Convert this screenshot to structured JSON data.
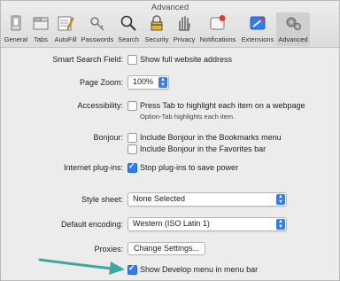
{
  "window": {
    "title": "Advanced"
  },
  "toolbar": {
    "items": [
      {
        "label": "General",
        "icon": "general-icon"
      },
      {
        "label": "Tabs",
        "icon": "tabs-icon"
      },
      {
        "label": "AutoFill",
        "icon": "autofill-icon"
      },
      {
        "label": "Passwords",
        "icon": "key-icon"
      },
      {
        "label": "Search",
        "icon": "magnifier-icon"
      },
      {
        "label": "Security",
        "icon": "lock-icon"
      },
      {
        "label": "Privacy",
        "icon": "hand-icon"
      },
      {
        "label": "Notifications",
        "icon": "notifications-icon"
      },
      {
        "label": "Extensions",
        "icon": "puzzle-icon"
      },
      {
        "label": "Advanced",
        "icon": "gears-icon",
        "active": true
      }
    ]
  },
  "settings": {
    "smart_search_label": "Smart Search Field:",
    "smart_search_option": "Show full website address",
    "page_zoom_label": "Page Zoom:",
    "page_zoom_value": "100%",
    "accessibility_label": "Accessibility:",
    "accessibility_option": "Press Tab to highlight each item on a webpage",
    "accessibility_note": "Option-Tab highlights each item.",
    "bonjour_label": "Bonjour:",
    "bonjour_option1": "Include Bonjour in the Bookmarks menu",
    "bonjour_option2": "Include Bonjour in the Favorites bar",
    "plugins_label": "Internet plug-ins:",
    "plugins_option": "Stop plug-ins to save power",
    "style_sheet_label": "Style sheet:",
    "style_sheet_value": "None Selected",
    "encoding_label": "Default encoding:",
    "encoding_value": "Western (ISO Latin 1)",
    "proxies_label": "Proxies:",
    "proxies_button": "Change Settings...",
    "develop_option": "Show Develop menu in menu bar"
  },
  "colors": {
    "accent": "#2f7cf6",
    "arrow": "#3fa7a0"
  }
}
